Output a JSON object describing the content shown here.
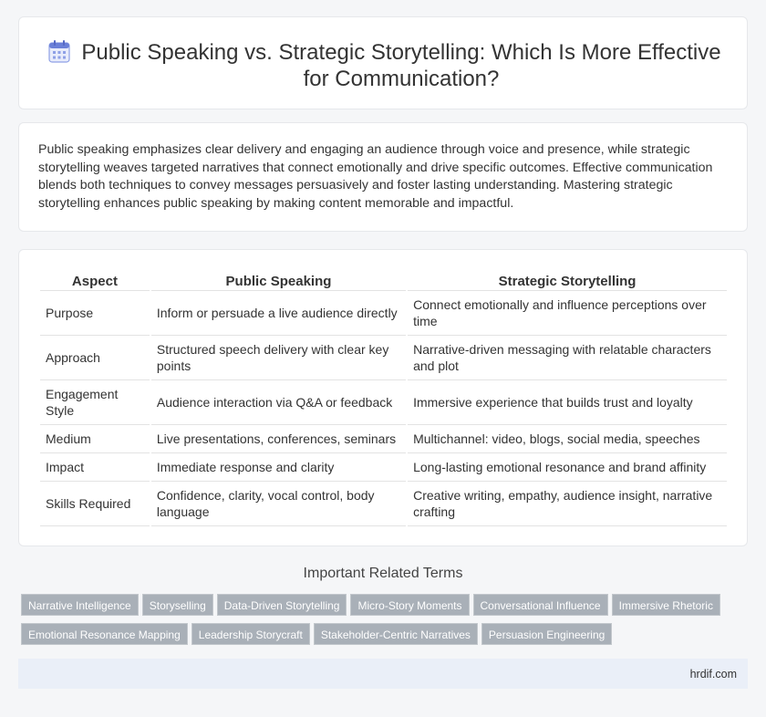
{
  "header": {
    "icon": "calendar-icon",
    "title": "Public Speaking vs. Strategic Storytelling: Which Is More Effective for Communication?"
  },
  "intro": {
    "text": "Public speaking emphasizes clear delivery and engaging an audience through voice and presence, while strategic storytelling weaves targeted narratives that connect emotionally and drive specific outcomes. Effective communication blends both techniques to convey messages persuasively and foster lasting understanding. Mastering strategic storytelling enhances public speaking by making content memorable and impactful."
  },
  "table": {
    "headers": [
      "Aspect",
      "Public Speaking",
      "Strategic Storytelling"
    ],
    "rows": [
      [
        "Purpose",
        "Inform or persuade a live audience directly",
        "Connect emotionally and influence perceptions over time"
      ],
      [
        "Approach",
        "Structured speech delivery with clear key points",
        "Narrative-driven messaging with relatable characters and plot"
      ],
      [
        "Engagement Style",
        "Audience interaction via Q&A or feedback",
        "Immersive experience that builds trust and loyalty"
      ],
      [
        "Medium",
        "Live presentations, conferences, seminars",
        "Multichannel: video, blogs, social media, speeches"
      ],
      [
        "Impact",
        "Immediate response and clarity",
        "Long-lasting emotional resonance and brand affinity"
      ],
      [
        "Skills Required",
        "Confidence, clarity, vocal control, body language",
        "Creative writing, empathy, audience insight, narrative crafting"
      ]
    ]
  },
  "related": {
    "title": "Important Related Terms",
    "tags": [
      "Narrative Intelligence",
      "Storyselling",
      "Data-Driven Storytelling",
      "Micro-Story Moments",
      "Conversational Influence",
      "Immersive Rhetoric",
      "Emotional Resonance Mapping",
      "Leadership Storycraft",
      "Stakeholder-Centric Narratives",
      "Persuasion Engineering"
    ]
  },
  "footer": {
    "site": "hrdif.com"
  },
  "colors": {
    "tag_bg": "#a9b0b8",
    "footer_bg": "#eaeff8",
    "icon_accent": "#6a7fd8"
  }
}
